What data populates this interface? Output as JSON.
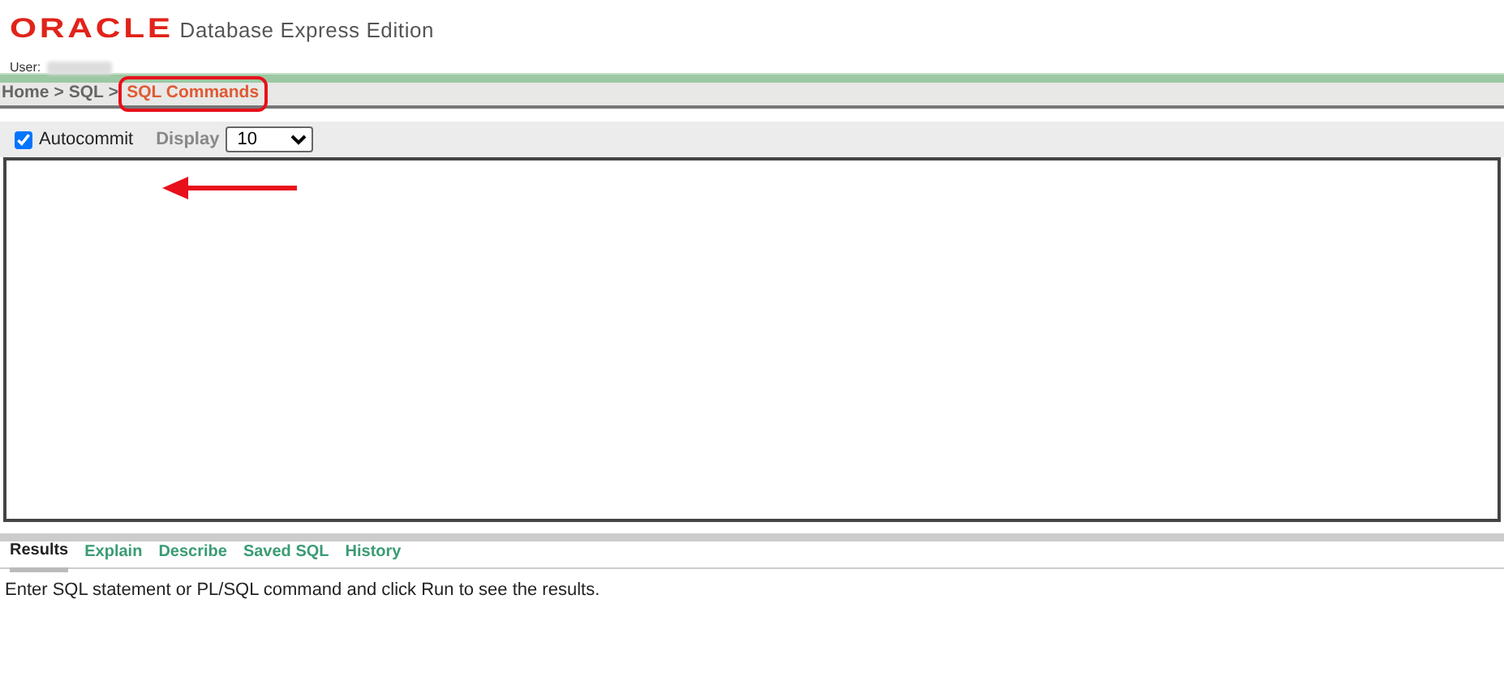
{
  "header": {
    "logo": "ORACLE",
    "product": "Database Express Edition",
    "user_label": "User:"
  },
  "breadcrumb": {
    "separator": ">",
    "items": [
      {
        "label": "Home",
        "current": false,
        "highlighted": false
      },
      {
        "label": "SQL",
        "current": false,
        "highlighted": false
      },
      {
        "label": "SQL Commands",
        "current": true,
        "highlighted": true
      }
    ]
  },
  "toolbar": {
    "autocommit": {
      "label": "Autocommit",
      "checked": true
    },
    "display": {
      "label": "Display",
      "value": "10"
    }
  },
  "editor": {
    "annotation": {
      "kind": "arrow"
    }
  },
  "tabs": [
    {
      "label": "Results",
      "selected": true
    },
    {
      "label": "Explain",
      "selected": false
    },
    {
      "label": "Describe",
      "selected": false
    },
    {
      "label": "Saved SQL",
      "selected": false
    },
    {
      "label": "History",
      "selected": false
    }
  ],
  "message": "Enter SQL statement or PL/SQL command and click Run to see the results."
}
